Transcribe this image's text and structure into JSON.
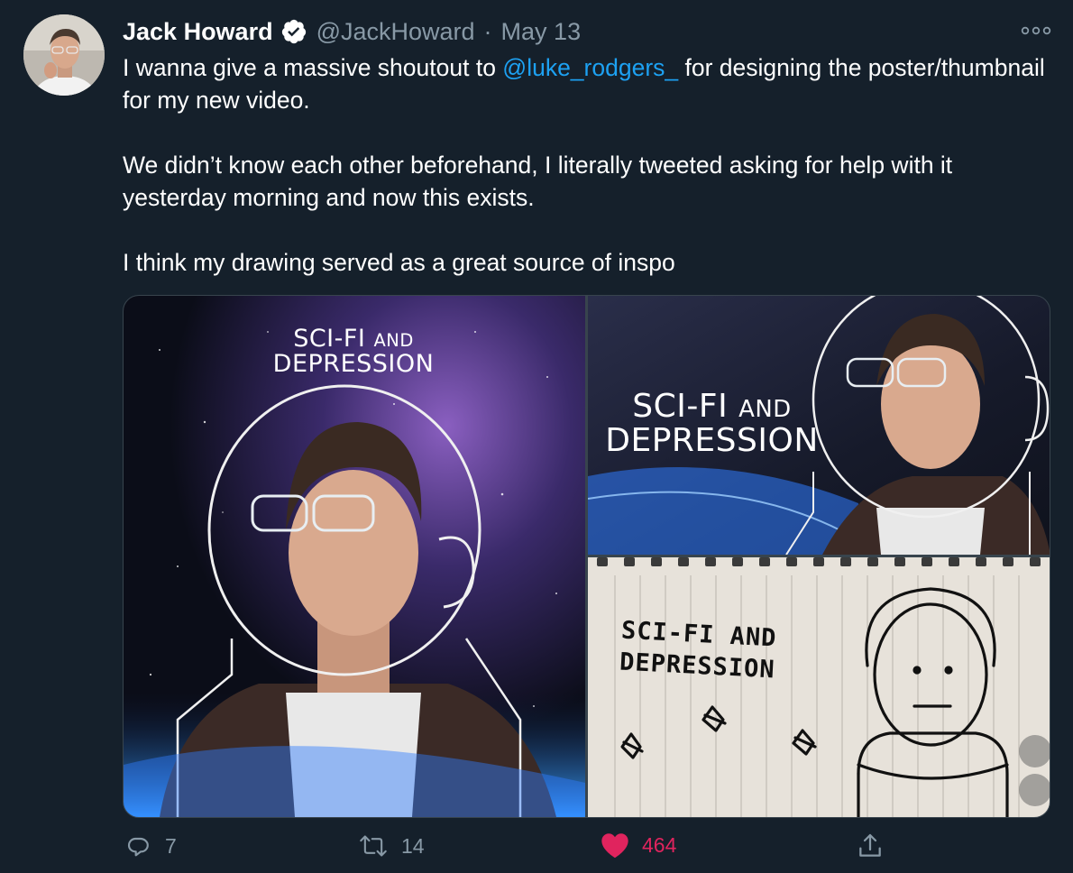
{
  "tweet": {
    "author_name": "Jack Howard",
    "author_handle": "@JackHoward",
    "separator": "·",
    "date": "May 13",
    "verified": true,
    "text": {
      "line1_before": "I wanna give a massive shoutout to ",
      "mention": "@luke_rodgers_",
      "line1_after": " for designing the poster/thumbnail for my new video.",
      "para2": "We didn’t know each other beforehand, I literally tweeted asking for help with it yesterday morning and now this exists.",
      "para3": "I think my drawing served as a great source of inspo"
    },
    "media": {
      "poster_title_main": "SCI-FI",
      "poster_title_and": "AND",
      "poster_title_line2": "DEPRESSION",
      "sketch_line1": "SCI-FI AND",
      "sketch_line2": "DEPRESSION"
    },
    "actions": {
      "reply_count": "7",
      "retweet_count": "14",
      "like_count": "464"
    }
  },
  "colors": {
    "background": "#15202b",
    "link": "#1da1f2",
    "secondary_text": "#8899a6",
    "like": "#e0245e",
    "verified_badge": "#ffffff"
  },
  "icons": [
    "verified-badge-icon",
    "more-icon",
    "reply-icon",
    "retweet-icon",
    "heart-icon",
    "share-icon"
  ]
}
